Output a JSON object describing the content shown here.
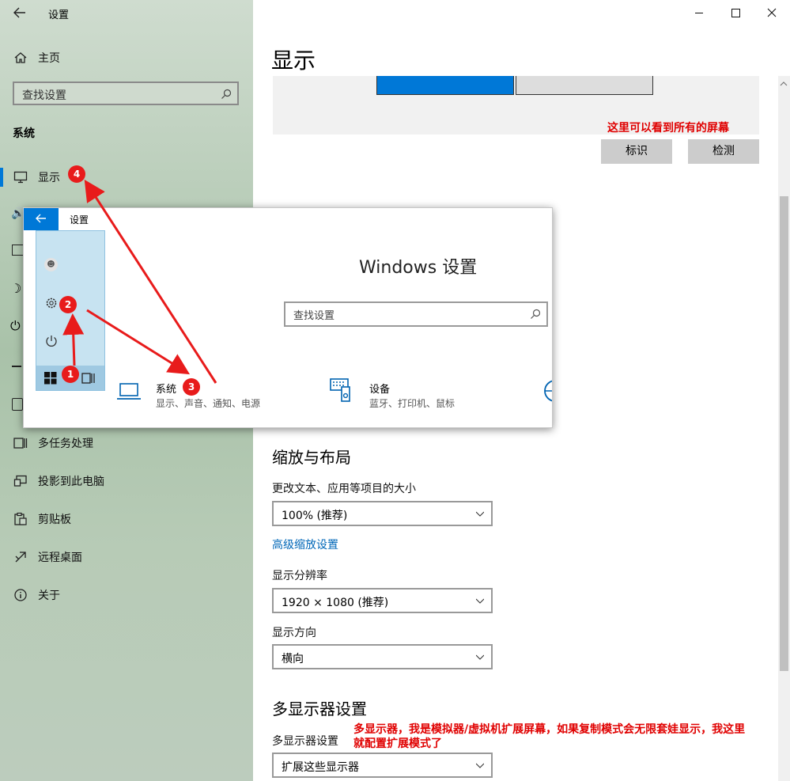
{
  "window": {
    "title": "设置",
    "controls": [
      "minimize",
      "maximize",
      "close"
    ]
  },
  "nav": {
    "home_label": "主页",
    "search_placeholder": "查找设置",
    "section_heading": "系统",
    "items": [
      {
        "label": "显示",
        "icon": "monitor-icon",
        "selected": true
      },
      {
        "label": "多任务处理",
        "icon": "multitask-icon"
      },
      {
        "label": "投影到此电脑",
        "icon": "project-icon"
      },
      {
        "label": "剪贴板",
        "icon": "clipboard-icon"
      },
      {
        "label": "远程桌面",
        "icon": "remote-desktop-icon"
      },
      {
        "label": "关于",
        "icon": "info-icon"
      }
    ]
  },
  "main": {
    "page_title": "显示",
    "arrange": {
      "note": "这里可以看到所有的屏幕",
      "identify_label": "标识",
      "detect_label": "检测"
    },
    "scale": {
      "section_title": "缩放与布局",
      "size_label": "更改文本、应用等项目的大小",
      "size_value": "100% (推荐)",
      "advanced_link": "高级缩放设置",
      "resolution_label": "显示分辨率",
      "resolution_value": "1920 × 1080 (推荐)",
      "orientation_label": "显示方向",
      "orientation_value": "横向"
    },
    "multi": {
      "section_title": "多显示器设置",
      "label": "多显示器设置",
      "value": "扩展这些显示器",
      "note_line1": "多显示器，我是模拟器/虚拟机扩展屏幕，如果复制模式会无限套娃显示，我这里",
      "note_line2": "就配置扩展模式了"
    }
  },
  "overlay": {
    "title": "设置",
    "heading": "Windows 设置",
    "search_placeholder": "查找设置",
    "system": {
      "title": "系统",
      "subtitle": "显示、声音、通知、电源"
    },
    "devices": {
      "title": "设备",
      "subtitle": "蓝牙、打印机、鼠标"
    },
    "badges": [
      "1",
      "2",
      "3",
      "4"
    ]
  },
  "colors": {
    "accent": "#0078d7",
    "annotation_red": "#e81b1b",
    "link": "#0067b8"
  }
}
